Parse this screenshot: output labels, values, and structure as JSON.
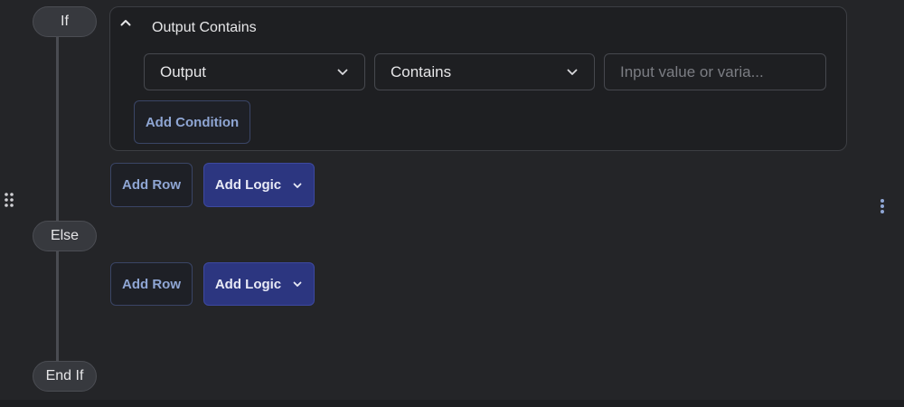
{
  "flow": {
    "if_label": "If",
    "else_label": "Else",
    "endif_label": "End If"
  },
  "condition": {
    "title": "Output Contains",
    "field_select": {
      "value": "Output"
    },
    "operator_select": {
      "value": "Contains"
    },
    "value_input": {
      "value": "",
      "placeholder": "Input value or varia..."
    },
    "add_condition_label": "Add Condition"
  },
  "if_branch": {
    "add_row_label": "Add Row",
    "add_logic_label": "Add Logic"
  },
  "else_branch": {
    "add_row_label": "Add Row",
    "add_logic_label": "Add Logic"
  },
  "icons": {
    "drag": "drag-handle-icon",
    "more": "more-vertical-icon",
    "collapse": "chevron-up-icon",
    "dropdown": "chevron-down-icon"
  },
  "colors": {
    "background": "#242528",
    "card": "#1e1f22",
    "primary": "#2c3680",
    "outline_text": "#8fa6d4"
  }
}
